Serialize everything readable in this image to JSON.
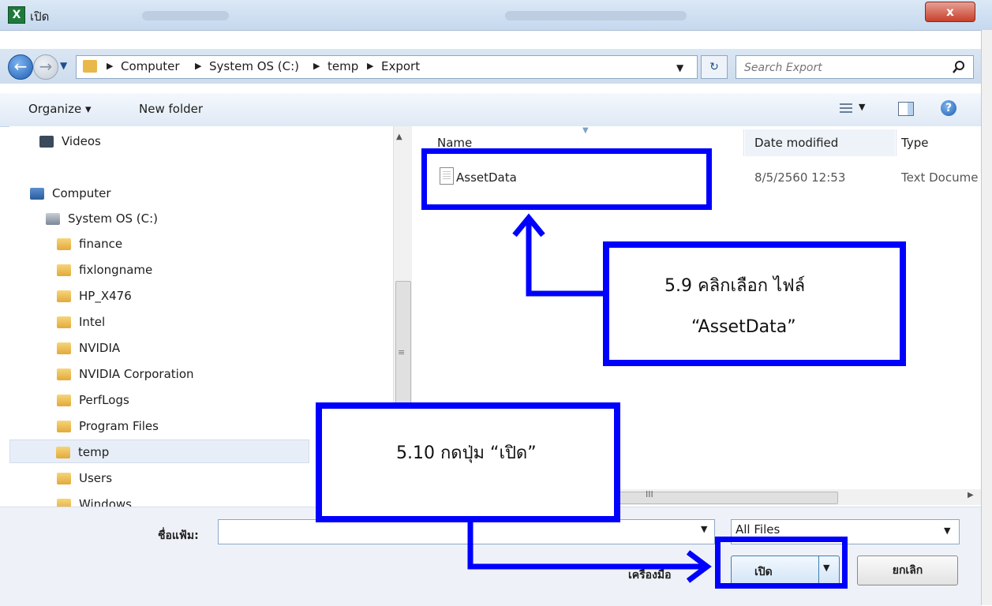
{
  "window": {
    "title": "เปิด",
    "app_icon": "X",
    "close_glyph": "x"
  },
  "address": {
    "crumbs": [
      "Computer",
      "System OS (C:)",
      "temp",
      "Export"
    ],
    "search_placeholder": "Search Export"
  },
  "toolbar": {
    "organize": "Organize ▾",
    "new_folder": "New folder"
  },
  "nav": {
    "items": [
      {
        "label": "Videos",
        "icon": "videos-icon"
      },
      {
        "label": "Computer",
        "icon": "computer-icon"
      },
      {
        "label": "System OS (C:)",
        "icon": "drive-icon"
      },
      {
        "label": "finance",
        "icon": "folder-icon"
      },
      {
        "label": "fixlongname",
        "icon": "folder-icon"
      },
      {
        "label": "HP_X476",
        "icon": "folder-icon"
      },
      {
        "label": "Intel",
        "icon": "folder-icon"
      },
      {
        "label": "NVIDIA",
        "icon": "folder-icon"
      },
      {
        "label": "NVIDIA Corporation",
        "icon": "folder-icon"
      },
      {
        "label": "PerfLogs",
        "icon": "folder-icon"
      },
      {
        "label": "Program Files",
        "icon": "folder-icon"
      },
      {
        "label": "temp",
        "icon": "folder-icon",
        "selected": true
      },
      {
        "label": "Users",
        "icon": "folder-icon"
      },
      {
        "label": "Windows",
        "icon": "folder-icon"
      }
    ]
  },
  "files": {
    "columns": {
      "name": "Name",
      "date": "Date modified",
      "type": "Type"
    },
    "rows": [
      {
        "name": "AssetData",
        "date": "8/5/2560 12:53",
        "type": "Text Docume"
      }
    ]
  },
  "bottom": {
    "filename_label": "ชื่อแฟ้ม:",
    "filename_value": "",
    "filetype_value": "All Files",
    "tools_label": "เครื่องมือ",
    "open_label": "เปิด",
    "cancel_label": "ยกเลิก"
  },
  "annotations": {
    "step_59_line1": "5.9 คลิกเลือก ไฟล์",
    "step_59_line2": "“AssetData”",
    "step_510": "5.10 กดปุ่ม “เปิด”"
  },
  "colors": {
    "annotation": "#0000ff",
    "title_bar": "#c5d8ee"
  }
}
